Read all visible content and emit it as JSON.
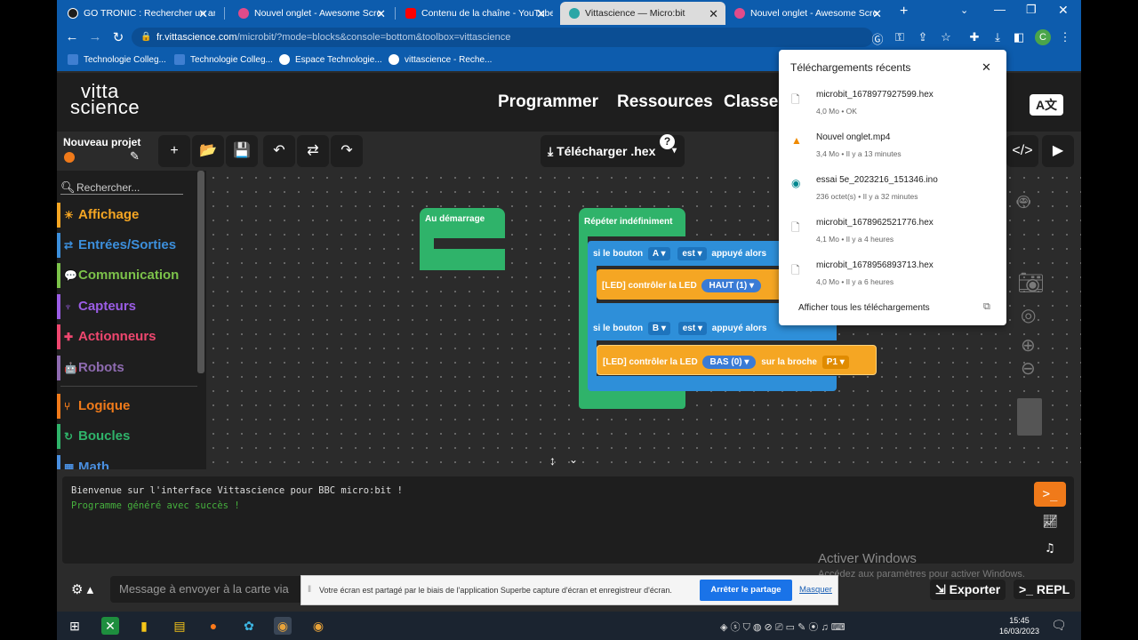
{
  "browser": {
    "tabs": [
      {
        "title": "GO TRONIC : Rechercher un arti",
        "icon": "gotronic-icon",
        "color": "#1d1d1d"
      },
      {
        "title": "Nouvel onglet - Awesome Scre",
        "icon": "awesome-screenshot-icon",
        "color": "#e14b8a"
      },
      {
        "title": "Contenu de la chaîne - YouTube",
        "icon": "youtube-icon",
        "color": "#ff0000"
      },
      {
        "title": "Vittascience — Micro:bit",
        "icon": "vittascience-icon",
        "color": "#2ba6a6"
      },
      {
        "title": "Nouvel onglet - Awesome Scre",
        "icon": "awesome-screenshot-icon",
        "color": "#e14b8a"
      }
    ],
    "url_host": "fr.vittascience.com",
    "url_path": "/microbit/?mode=blocks&console=bottom&toolbox=vittascience",
    "profile_initial": "C",
    "bookmarks": [
      {
        "label": "Technologie Colleg...",
        "icon": "bookmark-icon"
      },
      {
        "label": "Technologie Colleg...",
        "icon": "bookmark-icon"
      },
      {
        "label": "Espace Technologie...",
        "icon": "bookmark-icon"
      },
      {
        "label": "vittascience - Reche...",
        "icon": "google-icon"
      }
    ]
  },
  "vitta": {
    "logo_line1": "vitta",
    "logo_line2": "science",
    "nav": [
      "Programmer",
      "Ressources",
      "Classe"
    ],
    "lang_label": "A文",
    "project_name": "Nouveau projet",
    "download_label": "Télécharger .hex",
    "help_label": "?",
    "search_placeholder": "Rechercher...",
    "categories": [
      {
        "label": "Affichage",
        "color": "#f5a623",
        "icon": "☀"
      },
      {
        "label": "Entrées/Sorties",
        "color": "#3c8fdc",
        "icon": "⇄"
      },
      {
        "label": "Communication",
        "color": "#7cc24a",
        "icon": "💬"
      },
      {
        "label": "Capteurs",
        "color": "#9b5de5",
        "icon": "♆"
      },
      {
        "label": "Actionneurs",
        "color": "#ef476f",
        "icon": "✚"
      },
      {
        "label": "Robots",
        "color": "#8e6bb0",
        "icon": "🤖"
      },
      {
        "label": "Logique",
        "color": "#f07a1a",
        "icon": "⑂"
      },
      {
        "label": "Boucles",
        "color": "#2fb36a",
        "icon": "↻"
      },
      {
        "label": "Math",
        "color": "#4a8fe0",
        "icon": "▦"
      }
    ]
  },
  "blocks": {
    "start_label": "Au démarrage",
    "loop_label": "Répéter indéfiniment",
    "if_a_prefix": "si le bouton",
    "button_a": "A",
    "state_a": "est",
    "if_suffix": "appuyé alors",
    "if_b_prefix": "si le bouton",
    "button_b": "B",
    "state_b": "est",
    "led_label": "[LED] contrôler la LED",
    "led_a_value": "HAUT (1)",
    "led_b_value": "BAS (0)",
    "pin_label": "sur la broche",
    "pin_value": "P1"
  },
  "console": {
    "line1": "Bienvenue sur l'interface Vittascience pour BBC micro:bit !",
    "line2": "Programme généré avec succès !",
    "message_placeholder": "Message à envoyer à la carte via",
    "export_label": "Exporter",
    "repl_label": "REPL"
  },
  "windows": {
    "activate_title": "Activer Windows",
    "activate_sub": "Accédez aux paramètres pour activer Windows.",
    "clock_time": "15:45",
    "clock_date": "16/03/2023"
  },
  "sharebar": {
    "text": "Votre écran est partagé par le biais de l'application Superbe capture d'écran et enregistreur d'écran.",
    "stop_label": "Arrêter le partage",
    "hide_label": "Masquer"
  },
  "downloads": {
    "title": "Téléchargements récents",
    "show_all": "Afficher tous les téléchargements",
    "items": [
      {
        "name": "microbit_1678977927599.hex",
        "meta": "4,0 Mo • OK",
        "icon": "file-icon"
      },
      {
        "name": "Nouvel onglet.mp4",
        "meta": "3,4 Mo • Il y a 13 minutes",
        "icon": "vlc-icon"
      },
      {
        "name": "essai 5e_2023216_151346.ino",
        "meta": "236 octet(s) • Il y a 32 minutes",
        "icon": "arduino-icon"
      },
      {
        "name": "microbit_1678962521776.hex",
        "meta": "4,1 Mo • Il y a 4 heures",
        "icon": "file-icon"
      },
      {
        "name": "microbit_1678956893713.hex",
        "meta": "4,0 Mo • Il y a 6 heures",
        "icon": "file-icon"
      }
    ]
  }
}
